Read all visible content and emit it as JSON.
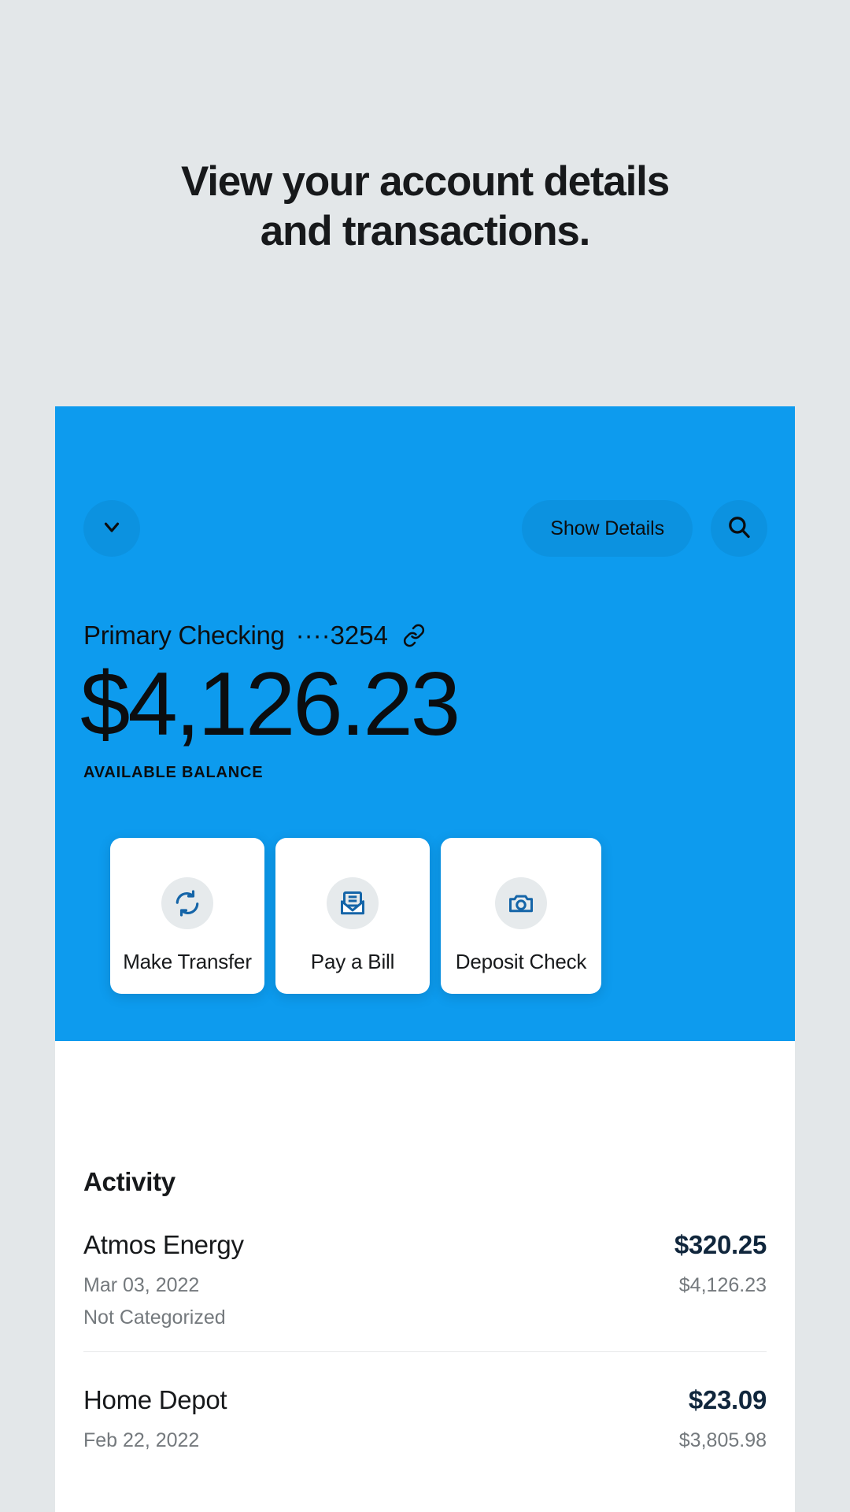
{
  "headline": {
    "line1": "View your account details",
    "line2": "and transactions."
  },
  "colors": {
    "page_background": "#e3e7e9",
    "hero_blue": "#0d9bee",
    "icon_blue": "#1565a8",
    "amount_navy": "#10263c",
    "muted_text": "#74797d"
  },
  "toolbar": {
    "collapse_icon": "chevron-down-icon",
    "show_details_label": "Show Details",
    "search_icon": "search-icon"
  },
  "account": {
    "name": "Primary Checking",
    "mask": "····3254",
    "link_icon": "link-icon",
    "balance": "$4,126.23",
    "balance_label": "AVAILABLE BALANCE"
  },
  "actions": [
    {
      "label": "Make Transfer",
      "icon": "transfer-sync-icon"
    },
    {
      "label": "Pay a Bill",
      "icon": "bill-envelope-icon"
    },
    {
      "label": "Deposit Check",
      "icon": "camera-icon"
    }
  ],
  "activity": {
    "title": "Activity",
    "transactions": [
      {
        "name": "Atmos Energy",
        "amount": "$320.25",
        "date": "Mar 03, 2022",
        "running_balance": "$4,126.23",
        "category": "Not Categorized"
      },
      {
        "name": "Home Depot",
        "amount": "$23.09",
        "date": "Feb 22, 2022",
        "running_balance": "$3,805.98",
        "category": ""
      }
    ]
  }
}
